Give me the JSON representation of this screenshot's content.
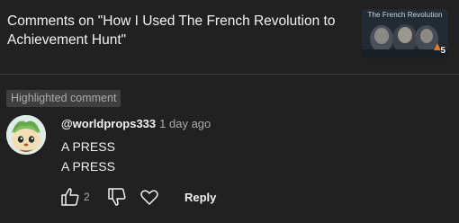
{
  "header": {
    "title": "Comments on \"How I Used The French Revolution to Achievement Hunt\""
  },
  "thumbnail": {
    "overlay_title": "The French Revolution",
    "badge_number": "5",
    "image": "video-thumbnail"
  },
  "highlight_label": "Highlighted comment",
  "comment": {
    "author": "@worldprops333",
    "time": "1 day ago",
    "lines": [
      "A PRESS",
      "A PRESS"
    ],
    "avatar": "chespin-avatar"
  },
  "actions": {
    "like_count": "2",
    "like_icon": "thumbs-up-icon",
    "dislike_icon": "thumbs-down-icon",
    "heart_icon": "heart-icon",
    "reply_label": "Reply"
  }
}
